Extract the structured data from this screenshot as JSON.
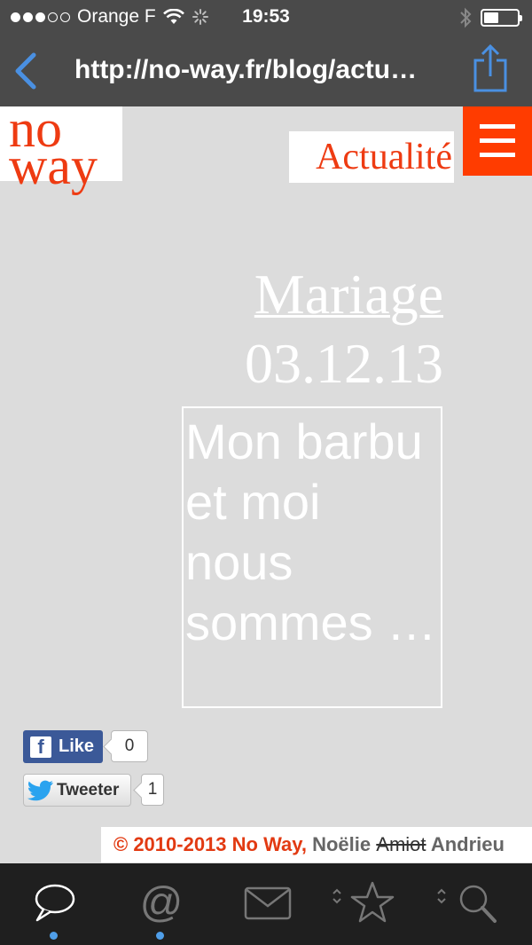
{
  "status_bar": {
    "carrier": "Orange F",
    "time": "19:53",
    "signal_bars": 3,
    "signal_total": 5,
    "battery_level": 0.45
  },
  "url_bar": {
    "url": "http://no-way.fr/blog/actu…"
  },
  "site": {
    "logo_line1": "no",
    "logo_line2": "way",
    "section": "Actualité",
    "brand_color": "#ff3c00"
  },
  "post": {
    "title": "Mariage",
    "date": "03.12.13",
    "excerpt": "Mon barbu et moi nous sommes …"
  },
  "social": {
    "like_label": "Like",
    "like_count": "0",
    "tweet_label": "Tweeter",
    "tweet_count": "1"
  },
  "footer": {
    "copyright": "© 2010-2013 No Way,",
    "author_first": "Noëlie",
    "author_struck": "Amiot",
    "author_last": "Andrieu"
  },
  "toolbar": {
    "items": [
      "chat-icon",
      "at-icon",
      "mail-icon",
      "star-icon",
      "search-icon"
    ],
    "accent": "#4f9ee8"
  }
}
